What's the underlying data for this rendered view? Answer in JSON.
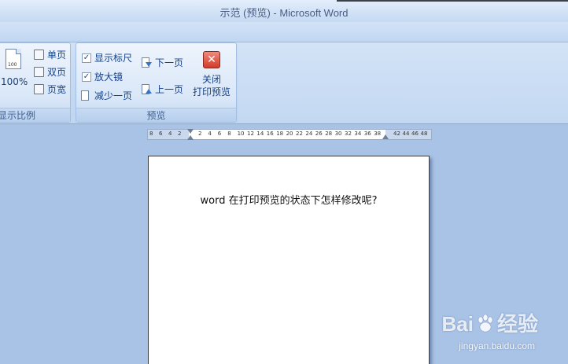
{
  "window": {
    "title": "示范 (预览) - Microsoft Word"
  },
  "ribbon": {
    "zoom_group": {
      "label": "显示比例",
      "zoom_level": "100%",
      "doc_icon_number": "100",
      "items": [
        {
          "label": "单页",
          "icon": "one-page-icon"
        },
        {
          "label": "双页",
          "icon": "two-pages-icon"
        },
        {
          "label": "页宽",
          "icon": "page-width-icon"
        }
      ]
    },
    "preview_group": {
      "label": "预览",
      "show_ruler": {
        "label": "显示标尺",
        "checked": true
      },
      "magnifier": {
        "label": "放大镜",
        "checked": true
      },
      "shrink_one_page": {
        "label": "减少一页",
        "icon": "shrink-page-icon"
      },
      "next_page": {
        "label": "下一页",
        "icon": "next-page-icon"
      },
      "prev_page": {
        "label": "上一页",
        "icon": "previous-page-icon"
      },
      "close": {
        "line1": "关闭",
        "line2": "打印预览",
        "icon": "close-icon"
      }
    }
  },
  "ruler": {
    "left_numbers": [
      "8",
      "6",
      "4",
      "2"
    ],
    "right_numbers": [
      "2",
      "4",
      "6",
      "8",
      "10",
      "12",
      "14",
      "16",
      "18",
      "20",
      "22",
      "24",
      "26",
      "28",
      "30",
      "32",
      "34",
      "36",
      "38"
    ],
    "tail_numbers": [
      "42",
      "44",
      "46",
      "48"
    ]
  },
  "document": {
    "text": "word 在打印预览的状态下怎样修改呢?"
  },
  "watermark": {
    "logo_text_left": "Bai",
    "logo_text_right": "经验",
    "url": "jingyan.baidu.com"
  },
  "colors": {
    "ribbon_bg": "#c8dcf4",
    "workspace_bg": "#a9c3e6",
    "close_red": "#d43a2a",
    "label_blue": "#15428b"
  }
}
